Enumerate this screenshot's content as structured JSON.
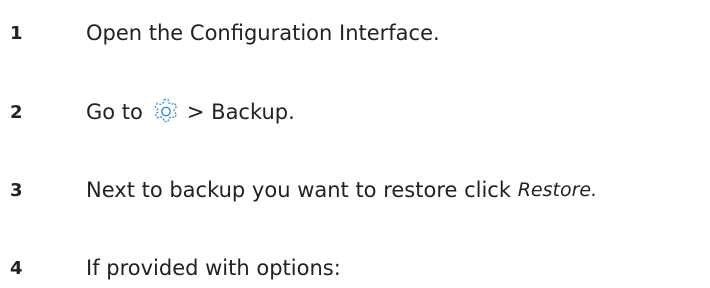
{
  "steps": [
    {
      "number": "1",
      "text": "Open the Configuration Interface."
    },
    {
      "number": "2",
      "text_before_icon": "Go to",
      "icon": "gear-icon",
      "text_after_icon": "> Backup."
    },
    {
      "number": "3",
      "text": "Next to backup you want to restore click",
      "action": "Restore."
    },
    {
      "number": "4",
      "text": "If provided with options:"
    }
  ],
  "colors": {
    "text": "#222222",
    "icon": "#3a8fd6"
  }
}
